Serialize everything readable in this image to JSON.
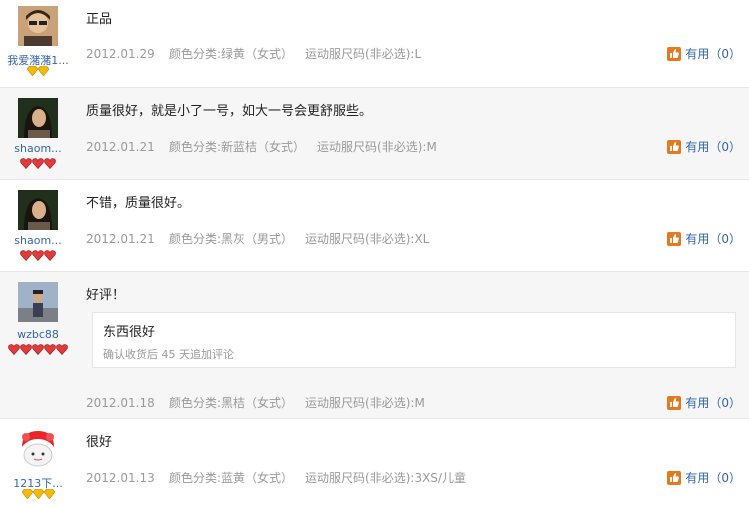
{
  "colors": {
    "link": "#3366aa",
    "meta": "#9a9a9a",
    "icon": "#e5791f",
    "alt_row": "#f6f6f6"
  },
  "reviews": [
    {
      "user": "我爱潴潴1...",
      "rank_icons": [
        "diamond-icon",
        "diamond-icon"
      ],
      "content": "正品",
      "date": "2012.01.29",
      "color_spec": "颜色分类:绿黄（女式）",
      "size_spec": "运动服尺码(非必选):L",
      "helpful": "有用（0）"
    },
    {
      "user": "shaom...",
      "rank_icons": [
        "heart-icon",
        "heart-icon",
        "heart-icon"
      ],
      "content": "质量很好，就是小了一号，如大一号会更舒服些。",
      "date": "2012.01.21",
      "color_spec": "颜色分类:新蓝桔（女式）",
      "size_spec": "运动服尺码(非必选):M",
      "helpful": "有用（0）"
    },
    {
      "user": "shaom...",
      "rank_icons": [
        "heart-icon",
        "heart-icon",
        "heart-icon"
      ],
      "content": "不错，质量很好。",
      "date": "2012.01.21",
      "color_spec": "颜色分类:黑灰（男式）",
      "size_spec": "运动服尺码(非必选):XL",
      "helpful": "有用（0）"
    },
    {
      "user": "wzbc88",
      "rank_icons": [
        "heart-icon",
        "heart-icon",
        "heart-icon",
        "heart-icon",
        "heart-icon"
      ],
      "content": "好评！",
      "append_text": "东西很好",
      "append_note": "确认收货后 45 天追加评论",
      "date": "2012.01.18",
      "color_spec": "颜色分类:黑桔（女式）",
      "size_spec": "运动服尺码(非必选):M",
      "helpful": "有用（0）"
    },
    {
      "user": "1213下...",
      "rank_icons": [
        "diamond-icon",
        "diamond-icon",
        "diamond-icon"
      ],
      "content": "很好",
      "date": "2012.01.13",
      "color_spec": "颜色分类:蓝黄（女式）",
      "size_spec": "运动服尺码(非必选):3XS/儿童",
      "helpful": "有用（0）"
    }
  ]
}
